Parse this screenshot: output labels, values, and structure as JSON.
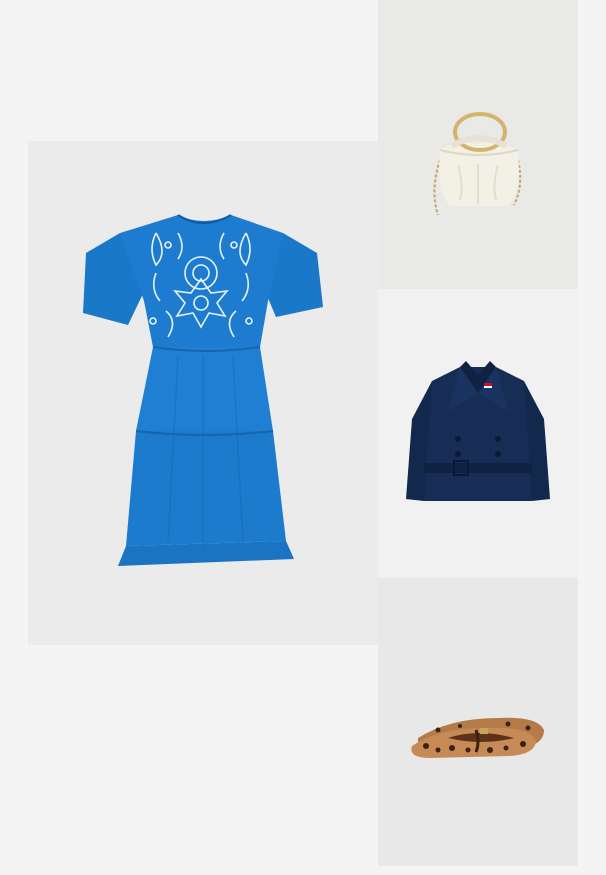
{
  "outfit": {
    "items": [
      {
        "name": "dress",
        "icon": "embroidered-dress-icon",
        "color": "#1d7ccf"
      },
      {
        "name": "bag",
        "icon": "handbag-icon",
        "color": "#f3f0e6"
      },
      {
        "name": "jacket",
        "icon": "cropped-jacket-icon",
        "color": "#13284d"
      },
      {
        "name": "shoes",
        "icon": "leopard-flats-icon",
        "color": "#c58a55"
      }
    ]
  }
}
